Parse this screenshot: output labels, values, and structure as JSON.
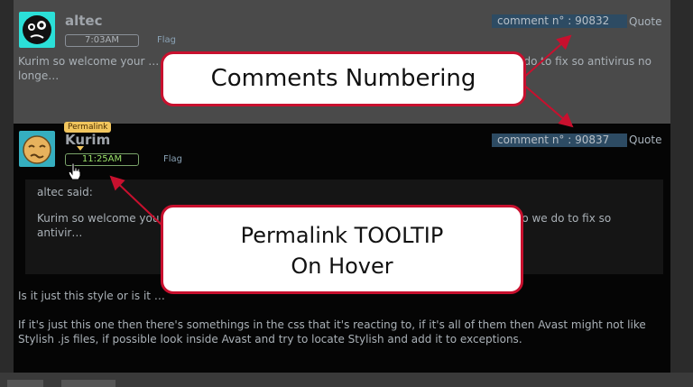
{
  "comments": [
    {
      "username": "altec",
      "time": "7:03AM",
      "flag": "Flag",
      "number_label": "comment n° : 90832",
      "quote": "Quote",
      "body": "Kurim so welcome your … have and it block this style. When I turn off ant… blem how do we do to fix so antivirus no longe…"
    },
    {
      "username": "Kurim",
      "time": "11:25AM",
      "flag": "Flag",
      "number_label": "comment n° : 90837",
      "quote": "Quote",
      "permalink": "Permalink",
      "quoted_author": "altec said:",
      "quoted_body": "Kurim so welcome you… ? I have and it block this style. When I turn… the problem how do we do to fix so antivir…",
      "reply_line1": "Is it just this style or is it …",
      "reply_line2": "If it's just this one then there's somethings in the css that it's reacting to, if it's all of them then Avast might not like Stylish .js files, if possible look inside Avast and try to locate Stylish and add it to exceptions."
    }
  ],
  "callouts": {
    "numbering": "Comments Numbering",
    "tooltip_line1": "Permalink TOOLTIP",
    "tooltip_line2": "On Hover"
  },
  "colors": {
    "accent_red": "#c8102e",
    "permalink_bg": "#f2c65e",
    "comment_number_bg": "#2d4b63"
  }
}
